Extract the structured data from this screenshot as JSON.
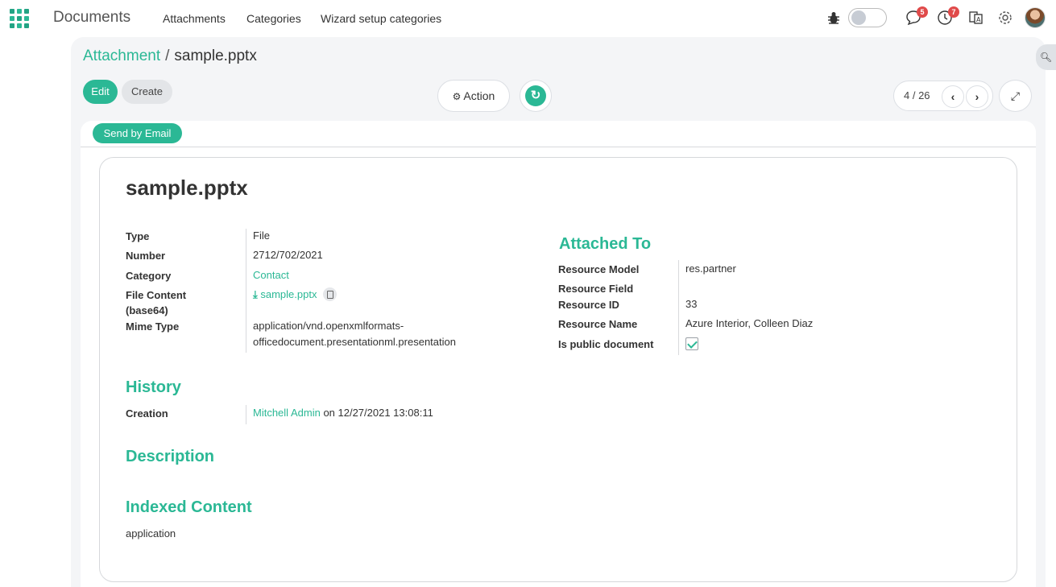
{
  "navbar": {
    "app_name": "Documents",
    "menu": [
      "Attachments",
      "Categories",
      "Wizard setup categories"
    ],
    "messages_badge": "5",
    "activities_badge": "7",
    "accent": "#2bb895"
  },
  "breadcrumb": {
    "parent": "Attachment",
    "separator": "/",
    "current": "sample.pptx"
  },
  "toolbar": {
    "edit_label": "Edit",
    "create_label": "Create",
    "action_label": "Action",
    "pager_value": "4 / 26"
  },
  "statusbar": {
    "send_email_label": "Send by Email"
  },
  "record": {
    "title": "sample.pptx",
    "fields": {
      "type_label": "Type",
      "type_value": "File",
      "number_label": "Number",
      "number_value": "2712/702/2021",
      "category_label": "Category",
      "category_value": "Contact",
      "file_content_label_1": "File Content",
      "file_content_label_2": "(base64)",
      "file_content_value": "sample.pptx",
      "mime_label": "Mime Type",
      "mime_value_1": "application/vnd.openxmlformats-",
      "mime_value_2": "officedocument.presentationml.presentation"
    },
    "attached_to": {
      "heading": "Attached To",
      "resource_model_label": "Resource Model",
      "resource_model_value": "res.partner",
      "resource_field_label": "Resource Field",
      "resource_id_label": "Resource ID",
      "resource_id_value": "33",
      "resource_name_label": "Resource Name",
      "resource_name_value": "Azure Interior, Colleen Diaz",
      "public_label": "Is public document",
      "public_value": true
    },
    "history": {
      "heading": "History",
      "creation_label": "Creation",
      "creation_user": "Mitchell Admin",
      "creation_on": "on 12/27/2021 13:08:11"
    },
    "description": {
      "heading": "Description"
    },
    "indexed_content": {
      "heading": "Indexed Content",
      "value": "application"
    }
  }
}
